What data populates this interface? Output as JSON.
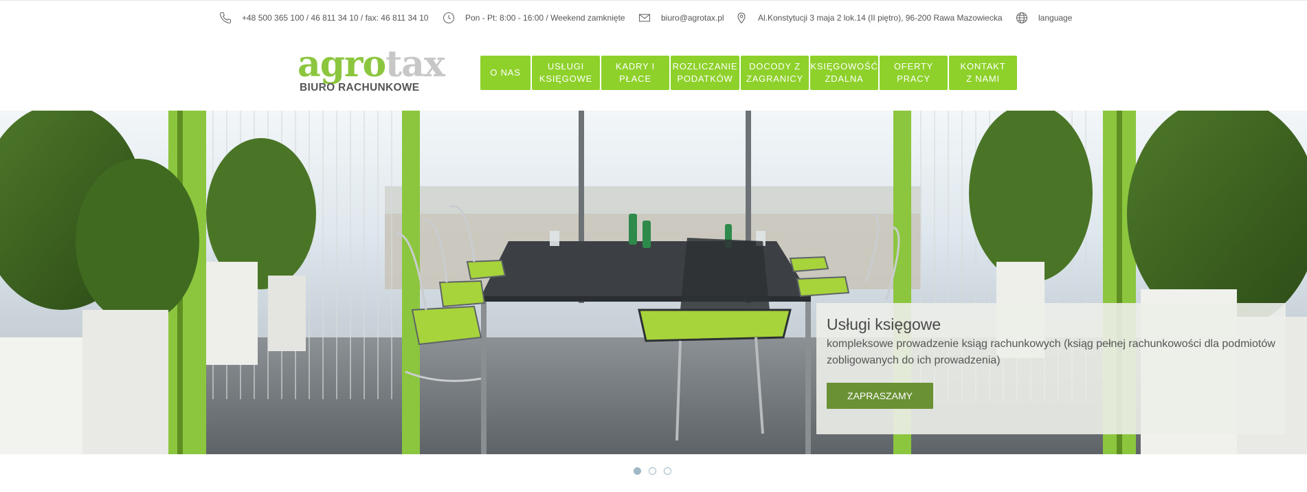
{
  "topbar": {
    "phone": "+48 500 365 100 / 46 811 34 10 / fax: 46 811 34 10",
    "hours": "Pon - Pt: 8:00 - 16:00 / Weekend zamknięte",
    "email": "biuro@agrotax.pl",
    "address": "Al.Konstytucji 3 maja 2 lok.14 (II piętro), 96-200 Rawa Mazowiecka",
    "language": "language"
  },
  "logo": {
    "word_part1": "agro",
    "word_part2": "tax",
    "subtitle": "BIURO RACHUNKOWE"
  },
  "nav": {
    "items": [
      {
        "label": "O NAS"
      },
      {
        "label": "USŁUGI\nKSIĘGOWE"
      },
      {
        "label": "KADRY I\nPŁACE"
      },
      {
        "label": "ROZLICZANIE\nPODATKÓW"
      },
      {
        "label": "DOCODY Z\nZAGRANICY"
      },
      {
        "label": "KSIĘGOWOŚĆ\nZDALNA"
      },
      {
        "label": "OFERTY\nPRACY"
      },
      {
        "label": "KONTAKT\nZ NAMI"
      }
    ]
  },
  "hero": {
    "title": "Usługi księgowe",
    "text": "kompleksowe prowadzenie ksiąg rachunkowych (ksiąg pełnej rachunkowości dla podmiotów zobligowanych do ich prowadzenia)",
    "button": "ZAPRASZAMY"
  },
  "slider": {
    "slide_count": 3,
    "active_index": 0
  },
  "colors": {
    "nav_green": "#8fd12b",
    "button_green": "#6a9235",
    "logo_green": "#8cc63f",
    "logo_gray": "#c7c7c7",
    "dot_color": "#9fb9c7"
  }
}
